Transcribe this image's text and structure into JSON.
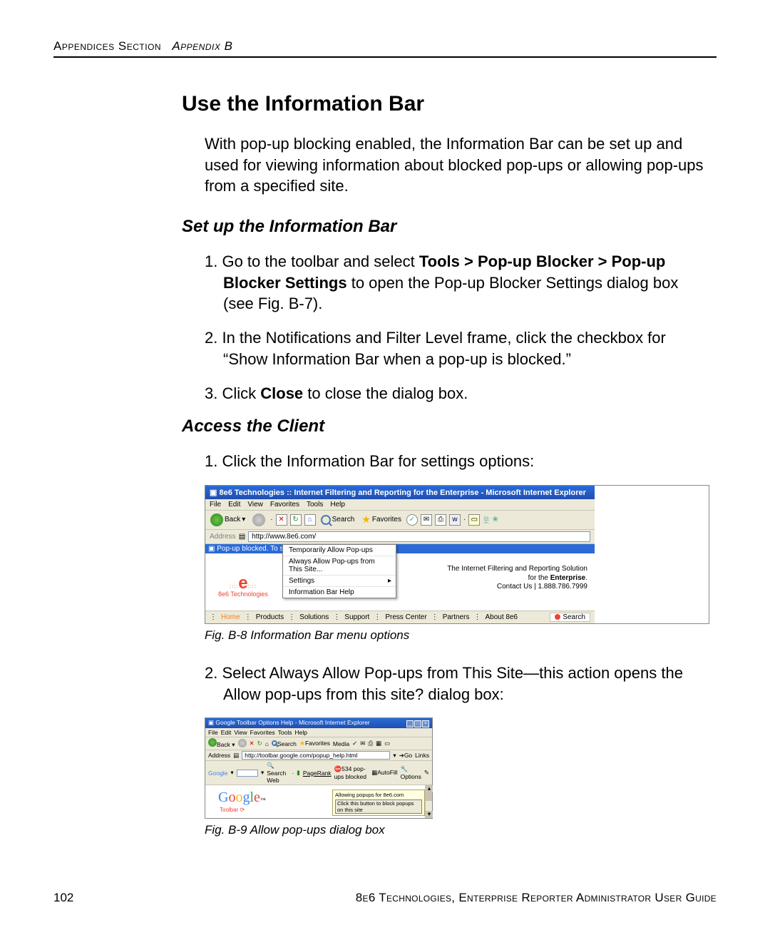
{
  "header": {
    "left": "Appendices Section",
    "right": "Appendix B"
  },
  "h1": "Use the Information Bar",
  "intro": "With pop-up blocking enabled, the Information Bar can be set up and used for viewing information about blocked pop-ups or allowing pop-ups from a specified site.",
  "sec1": {
    "heading": "Set up the Information Bar",
    "step1_a": "1. Go to the toolbar and select ",
    "step1_b": "Tools > Pop-up Blocker > Pop-up Blocker Settings",
    "step1_c": " to open the Pop-up Blocker Settings dialog box (see Fig. B-7).",
    "step2": "2. In the Notifications and Filter Level frame, click the checkbox for “Show Information Bar when a pop-up is blocked.”",
    "step3_a": "3. Click ",
    "step3_b": "Close",
    "step3_c": " to close the dialog box."
  },
  "sec2": {
    "heading": "Access the Client",
    "step1": "1. Click the Information Bar for settings options:",
    "caption1": "Fig. B-8  Information Bar menu options",
    "step2": "2. Select Always Allow Pop-ups from This Site—this action opens the Allow pop-ups from this site? dialog box:",
    "caption2": "Fig. B-9  Allow pop-ups dialog box"
  },
  "figB8": {
    "title": "8e6 Technologies :: Internet Filtering and Reporting for the Enterprise - Microsoft Internet Explorer",
    "menu": [
      "File",
      "Edit",
      "View",
      "Favorites",
      "Tools",
      "Help"
    ],
    "back": "Back",
    "search": "Search",
    "favorites": "Favorites",
    "addr_label": "Address",
    "url": "http://www.8e6.com/",
    "infobar": "Pop-up blocked. To see thi",
    "ctx": [
      "Temporarily Allow Pop-ups",
      "Always Allow Pop-ups from This Site...",
      "Settings",
      "Information Bar Help"
    ],
    "logo": "8e6 Technologies",
    "tag1": "The Internet Filtering and Reporting Solution",
    "tag2a": "for the ",
    "tag2b": "Enterprise",
    "tag3": "Contact Us  |  1.888.786.7999",
    "nav": [
      "Home",
      "Products",
      "Solutions",
      "Support",
      "Press Center",
      "Partners",
      "About 8e6"
    ],
    "search_chip": "Search"
  },
  "figB9": {
    "title": "Google Toolbar Options Help - Microsoft Internet Explorer",
    "menu": [
      "File",
      "Edit",
      "View",
      "Favorites",
      "Tools",
      "Help"
    ],
    "back": "Back",
    "searchbtn": "Search",
    "fav": "Favorites",
    "media": "Media",
    "addr_label": "Address",
    "url": "http://toolbar.google.com/popup_help.html",
    "go": "Go",
    "links": "Links",
    "goog_label": "Google",
    "searchweb": "Search Web",
    "pagerank": "PageRank",
    "blocked": "534 pop-ups blocked",
    "autofill": "AutoFill",
    "options": "Options",
    "toolbar_txt": "Toolbar",
    "allow_head": "Allowing popups for 8e6.com",
    "allow_btn": "Click this button to block popups on this site"
  },
  "footer": {
    "page": "102",
    "right": "8e6 Technologies, Enterprise Reporter Administrator User Guide"
  }
}
